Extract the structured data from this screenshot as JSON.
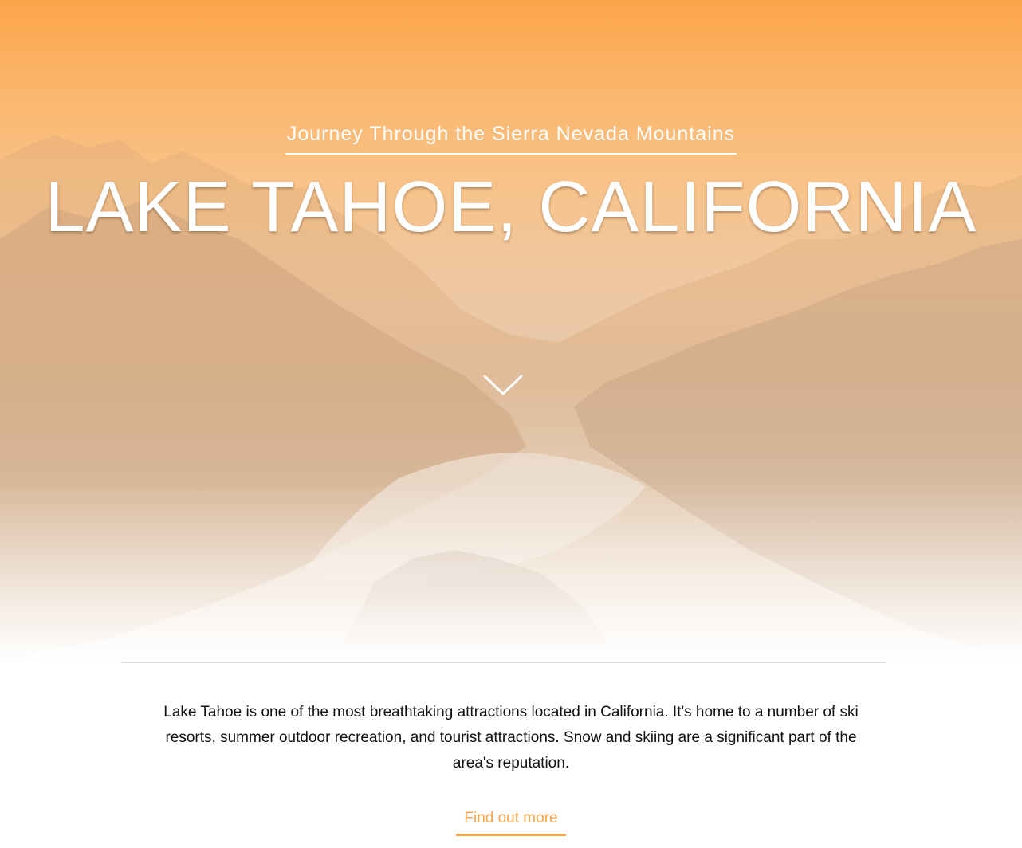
{
  "hero": {
    "subtitle": "Journey Through the Sierra Nevada Mountains",
    "title": "LAKE TAHOE, CALIFORNIA",
    "scroll_icon": "chevron-down-icon",
    "overlay_color": "#fca54a"
  },
  "intro": {
    "text": "Lake Tahoe is one of the most breathtaking attractions located in California. It's home to a number of ski resorts, summer outdoor recreation, and tourist attractions. Snow and skiing are a significant part of the area's reputation."
  },
  "cta": {
    "label": "Find out more",
    "color": "#fca54a"
  }
}
